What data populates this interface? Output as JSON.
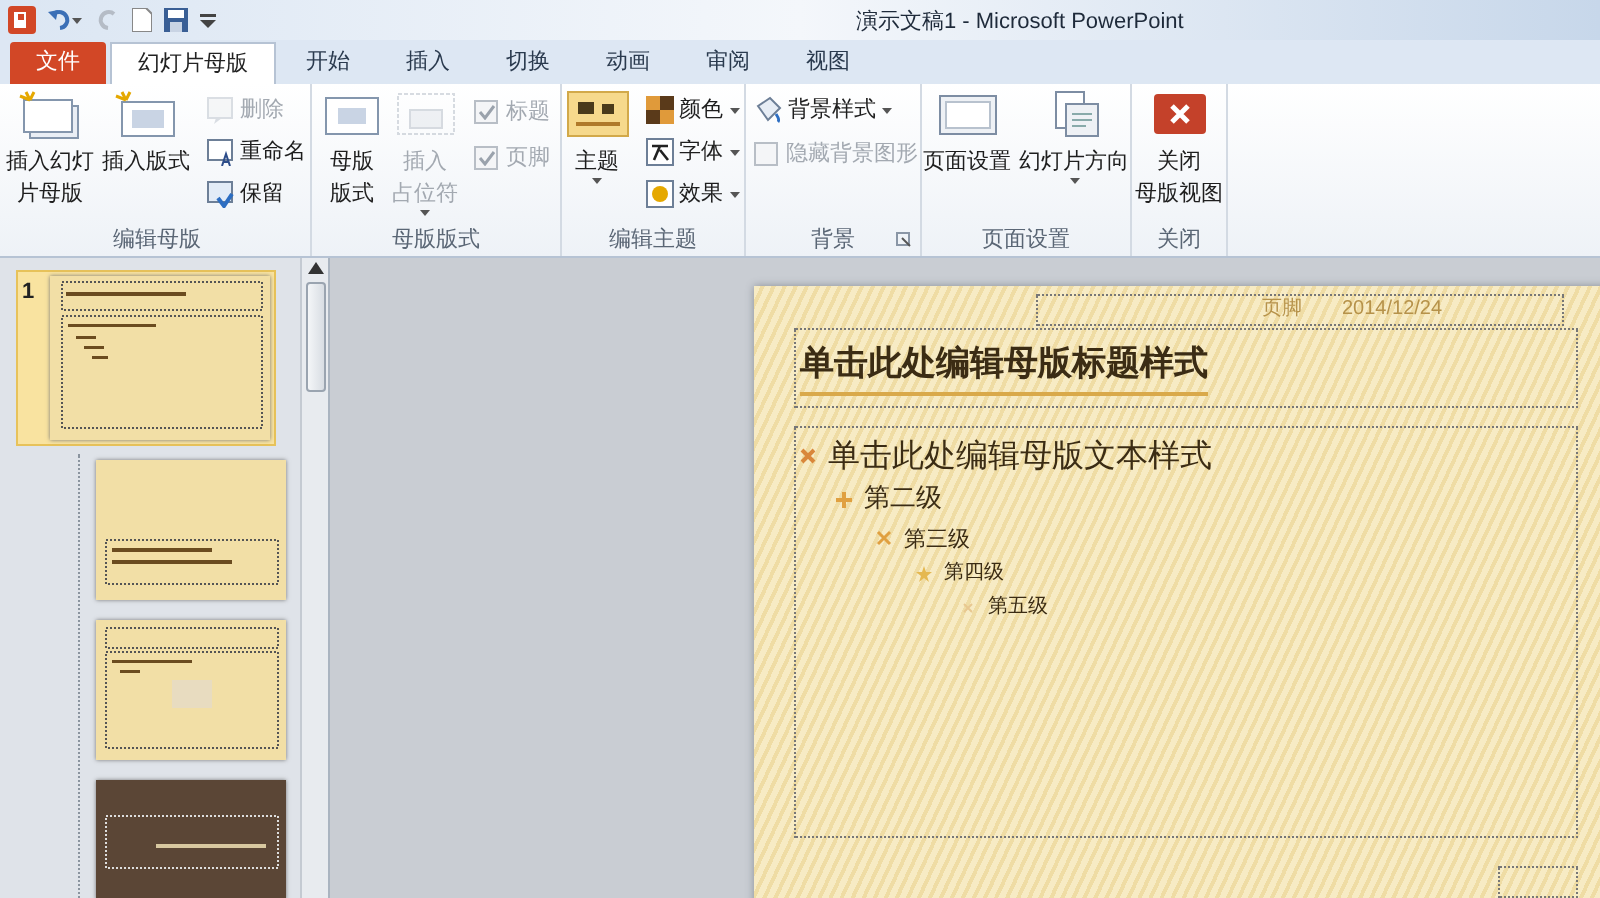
{
  "window": {
    "title": "演示文稿1 - Microsoft PowerPoint"
  },
  "tabs": [
    {
      "label": "文件",
      "kind": "file",
      "selected": false
    },
    {
      "label": "幻灯片母版",
      "kind": "tab",
      "selected": true
    },
    {
      "label": "开始",
      "kind": "tab",
      "selected": false
    },
    {
      "label": "插入",
      "kind": "tab",
      "selected": false
    },
    {
      "label": "切换",
      "kind": "tab",
      "selected": false
    },
    {
      "label": "动画",
      "kind": "tab",
      "selected": false
    },
    {
      "label": "审阅",
      "kind": "tab",
      "selected": false
    },
    {
      "label": "视图",
      "kind": "tab",
      "selected": false
    }
  ],
  "ribbon": {
    "groups": [
      {
        "label": "编辑母版",
        "items": [
          {
            "kind": "large",
            "lines": [
              "插入幻灯",
              "片母版"
            ],
            "disabled": false
          },
          {
            "kind": "large",
            "lines": [
              "插入版式"
            ],
            "disabled": false
          },
          {
            "kind": "stack",
            "items": [
              {
                "kind": "small",
                "label": "删除",
                "disabled": true
              },
              {
                "kind": "small",
                "label": "重命名",
                "disabled": false
              },
              {
                "kind": "small",
                "label": "保留",
                "disabled": false
              }
            ]
          }
        ]
      },
      {
        "label": "母版版式",
        "items": [
          {
            "kind": "large",
            "lines": [
              "母版",
              "版式"
            ],
            "disabled": false
          },
          {
            "kind": "large",
            "lines": [
              "插入",
              "占位符"
            ],
            "disabled": true,
            "dropdown": true
          },
          {
            "kind": "stack",
            "items": [
              {
                "kind": "check",
                "label": "标题",
                "checked": true,
                "disabled": true
              },
              {
                "kind": "check",
                "label": "页脚",
                "checked": true,
                "disabled": true
              }
            ]
          }
        ]
      },
      {
        "label": "编辑主题",
        "items": [
          {
            "kind": "large",
            "lines": [
              "主题"
            ],
            "disabled": false,
            "dropdown": true
          },
          {
            "kind": "stack",
            "items": [
              {
                "kind": "small",
                "label": "颜色",
                "disabled": false,
                "dropdown": true
              },
              {
                "kind": "small",
                "label": "字体",
                "disabled": false,
                "dropdown": true
              },
              {
                "kind": "small",
                "label": "效果",
                "disabled": false,
                "dropdown": true
              }
            ]
          }
        ]
      },
      {
        "label": "背景",
        "launcher": true,
        "items": [
          {
            "kind": "stack",
            "items": [
              {
                "kind": "small",
                "label": "背景样式",
                "disabled": false,
                "dropdown": true
              },
              {
                "kind": "check",
                "label": "隐藏背景图形",
                "checked": false,
                "disabled": true
              }
            ]
          }
        ]
      },
      {
        "label": "页面设置",
        "items": [
          {
            "kind": "large",
            "lines": [
              "页面设置"
            ],
            "disabled": false
          },
          {
            "kind": "large",
            "lines": [
              "幻灯片方向"
            ],
            "disabled": false,
            "dropdown": true
          }
        ]
      },
      {
        "label": "关闭",
        "items": [
          {
            "kind": "large",
            "lines": [
              "关闭",
              "母版视图"
            ],
            "disabled": false
          }
        ]
      }
    ]
  },
  "thumbnails": [
    {
      "number": "1",
      "kind": "master",
      "selected": true
    },
    {
      "kind": "light-title",
      "selected": false
    },
    {
      "kind": "light-content",
      "selected": false
    },
    {
      "kind": "dark",
      "selected": false
    }
  ],
  "slide": {
    "footer": "页脚",
    "date": "2014/12/24",
    "title": "单击此处编辑母版标题样式",
    "body": [
      {
        "text": "单击此处编辑母版文本样式",
        "children": [
          {
            "text": "第二级",
            "children": [
              {
                "text": "第三级",
                "children": [
                  {
                    "text": "第四级",
                    "children": [
                      {
                        "text": "第五级"
                      }
                    ]
                  }
                ]
              }
            ]
          }
        ]
      }
    ]
  }
}
